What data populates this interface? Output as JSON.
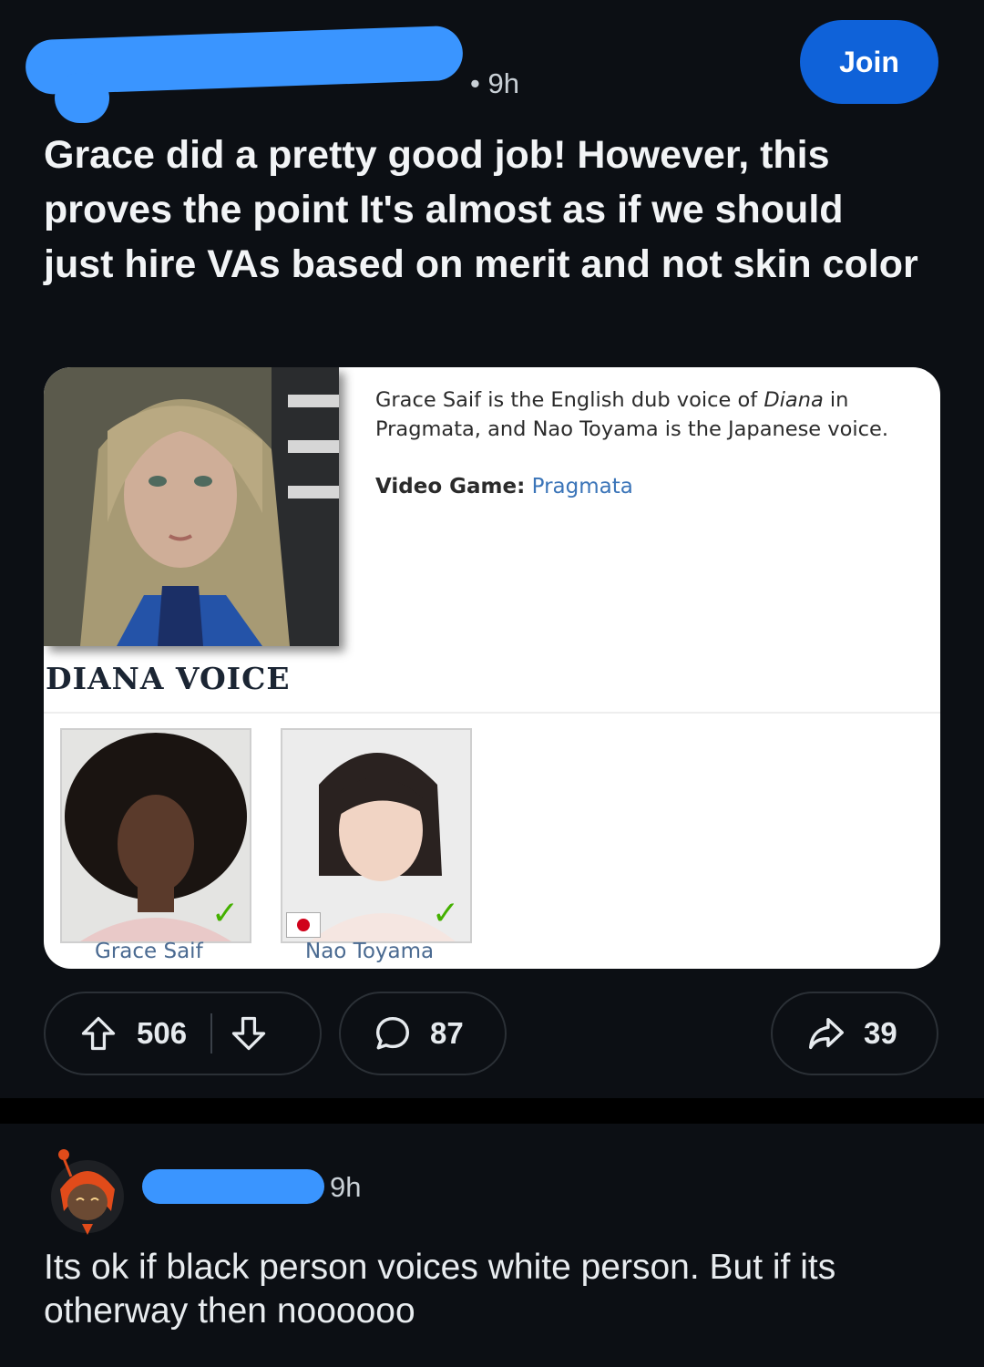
{
  "post": {
    "time": "• 9h",
    "join_label": "Join",
    "title": "Grace did a pretty good job! However, this proves the point It's almost as if we should just hire VAs based on merit and not skin color"
  },
  "card": {
    "desc_part1": "Grace Saif is the English dub voice of ",
    "desc_italic": "Diana",
    "desc_part2": " in Pragmata, and Nao Toyama is the Japanese voice.",
    "video_game_label": "Video Game:",
    "video_game_link": "Pragmata",
    "character_label": "DIANA VOICE",
    "voice_actors": [
      {
        "name": "Grace Saif",
        "flag": ""
      },
      {
        "name": "Nao Toyama",
        "flag": "Japan"
      }
    ]
  },
  "actions": {
    "upvotes": "506",
    "comments": "87",
    "shares": "39"
  },
  "comment": {
    "time": "9h",
    "text": "Its ok if black person voices white person. But if its otherway then noooooo"
  },
  "colors": {
    "background": "#0c0f14",
    "join_button": "#0f62d9",
    "redaction": "#3a95ff",
    "link": "#3a74b8",
    "check": "#44b000"
  }
}
